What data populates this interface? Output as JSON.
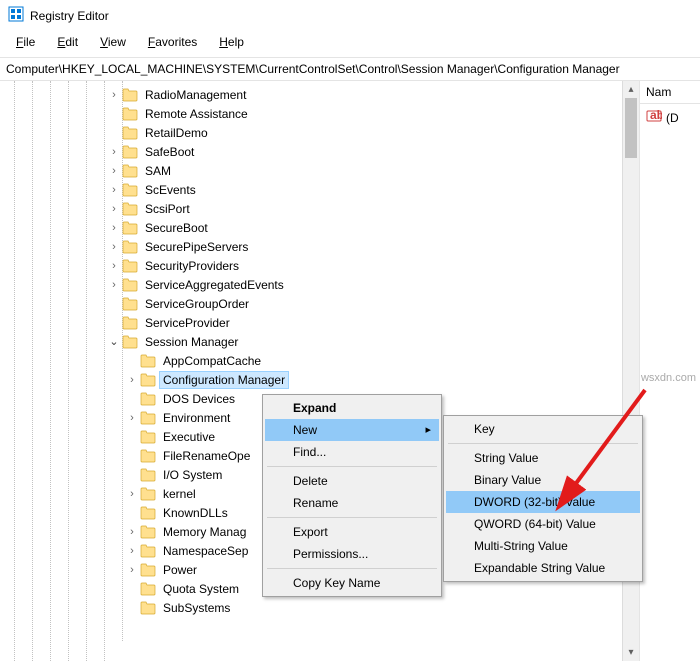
{
  "window": {
    "title": "Registry Editor"
  },
  "menu": {
    "items": [
      "File",
      "Edit",
      "View",
      "Favorites",
      "Help"
    ]
  },
  "address": "Computer\\HKEY_LOCAL_MACHINE\\SYSTEM\\CurrentControlSet\\Control\\Session Manager\\Configuration Manager",
  "valuepane": {
    "header": "Nam",
    "row0": "(D"
  },
  "tree": {
    "items": [
      {
        "indent": 6,
        "exp": ">",
        "label": "RadioManagement"
      },
      {
        "indent": 6,
        "exp": "",
        "label": "Remote Assistance"
      },
      {
        "indent": 6,
        "exp": "",
        "label": "RetailDemo"
      },
      {
        "indent": 6,
        "exp": ">",
        "label": "SafeBoot"
      },
      {
        "indent": 6,
        "exp": ">",
        "label": "SAM"
      },
      {
        "indent": 6,
        "exp": ">",
        "label": "ScEvents"
      },
      {
        "indent": 6,
        "exp": ">",
        "label": "ScsiPort"
      },
      {
        "indent": 6,
        "exp": ">",
        "label": "SecureBoot"
      },
      {
        "indent": 6,
        "exp": ">",
        "label": "SecurePipeServers"
      },
      {
        "indent": 6,
        "exp": ">",
        "label": "SecurityProviders"
      },
      {
        "indent": 6,
        "exp": ">",
        "label": "ServiceAggregatedEvents"
      },
      {
        "indent": 6,
        "exp": "",
        "label": "ServiceGroupOrder"
      },
      {
        "indent": 6,
        "exp": "",
        "label": "ServiceProvider"
      },
      {
        "indent": 6,
        "exp": "v",
        "label": "Session Manager"
      },
      {
        "indent": 7,
        "exp": "",
        "label": "AppCompatCache"
      },
      {
        "indent": 7,
        "exp": ">",
        "label": "Configuration Manager",
        "selected": true
      },
      {
        "indent": 7,
        "exp": "",
        "label": "DOS Devices"
      },
      {
        "indent": 7,
        "exp": ">",
        "label": "Environment"
      },
      {
        "indent": 7,
        "exp": "",
        "label": "Executive"
      },
      {
        "indent": 7,
        "exp": "",
        "label": "FileRenameOpe"
      },
      {
        "indent": 7,
        "exp": "",
        "label": "I/O System"
      },
      {
        "indent": 7,
        "exp": ">",
        "label": "kernel"
      },
      {
        "indent": 7,
        "exp": "",
        "label": "KnownDLLs"
      },
      {
        "indent": 7,
        "exp": ">",
        "label": "Memory Manag"
      },
      {
        "indent": 7,
        "exp": ">",
        "label": "NamespaceSep"
      },
      {
        "indent": 7,
        "exp": ">",
        "label": "Power"
      },
      {
        "indent": 7,
        "exp": "",
        "label": "Quota System"
      },
      {
        "indent": 7,
        "exp": "",
        "label": "SubSystems"
      }
    ]
  },
  "ctx1": {
    "expand": "Expand",
    "new": "New",
    "find": "Find...",
    "delete": "Delete",
    "rename": "Rename",
    "export": "Export",
    "permissions": "Permissions...",
    "copykey": "Copy Key Name"
  },
  "ctx2": {
    "key": "Key",
    "string": "String Value",
    "binary": "Binary Value",
    "dword": "DWORD (32-bit) Value",
    "qword": "QWORD (64-bit) Value",
    "multi": "Multi-String Value",
    "expand": "Expandable String Value"
  },
  "watermark": "wsxdn.com"
}
